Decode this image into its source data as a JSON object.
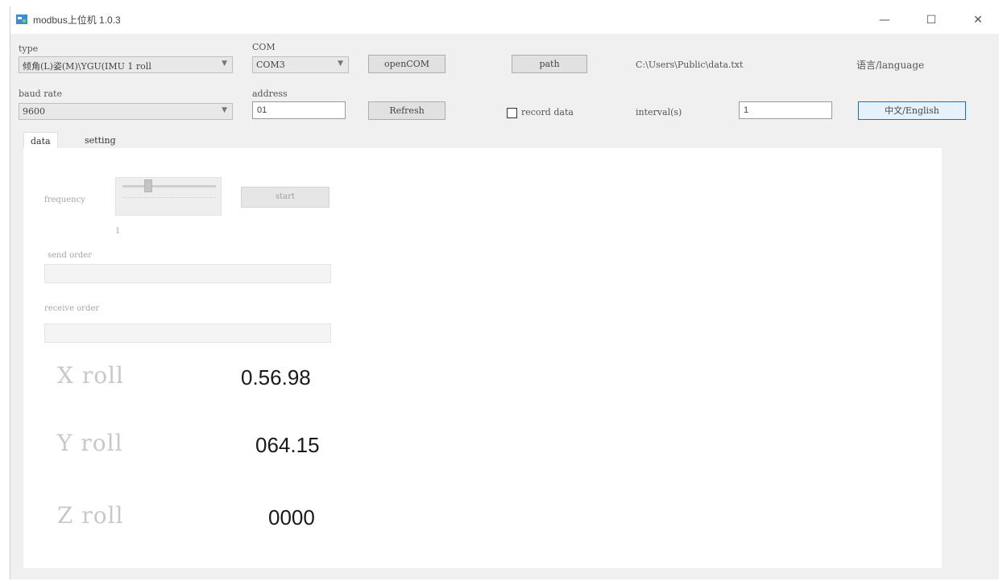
{
  "window": {
    "title": "modbus上位机  1.0.3",
    "minimize": "—",
    "maximize": "☐",
    "close": "✕"
  },
  "config": {
    "type_label": "type",
    "type_value": "倾角(L)姿(M)\\YGU(IMU 1 roll",
    "com_label": "COM",
    "com_value": "COM3",
    "open_com": "openCOM",
    "path_button": "path",
    "path_value": "C:\\Users\\Public\\data.txt",
    "language_label": "语言/language",
    "baud_label": "baud rate",
    "baud_value": "9600",
    "address_label": "address",
    "address_value": "01",
    "refresh": "Refresh",
    "record_label": "record data",
    "interval_label": "interval(s)",
    "interval_value": "1",
    "language_button": "中文/English"
  },
  "tabs": [
    {
      "label": "data"
    },
    {
      "label": "setting"
    }
  ],
  "data_panel": {
    "frequency_label": "frequency",
    "slider_value": "1",
    "slider_level": 0.25,
    "start_button": "start",
    "send_order_label": "send order",
    "receive_order_label": "receive order",
    "rolls": [
      {
        "label": "X roll",
        "value": "0.56.98"
      },
      {
        "label": "Y roll",
        "value": "064.15"
      },
      {
        "label": "Z roll",
        "value": "0000"
      }
    ]
  }
}
